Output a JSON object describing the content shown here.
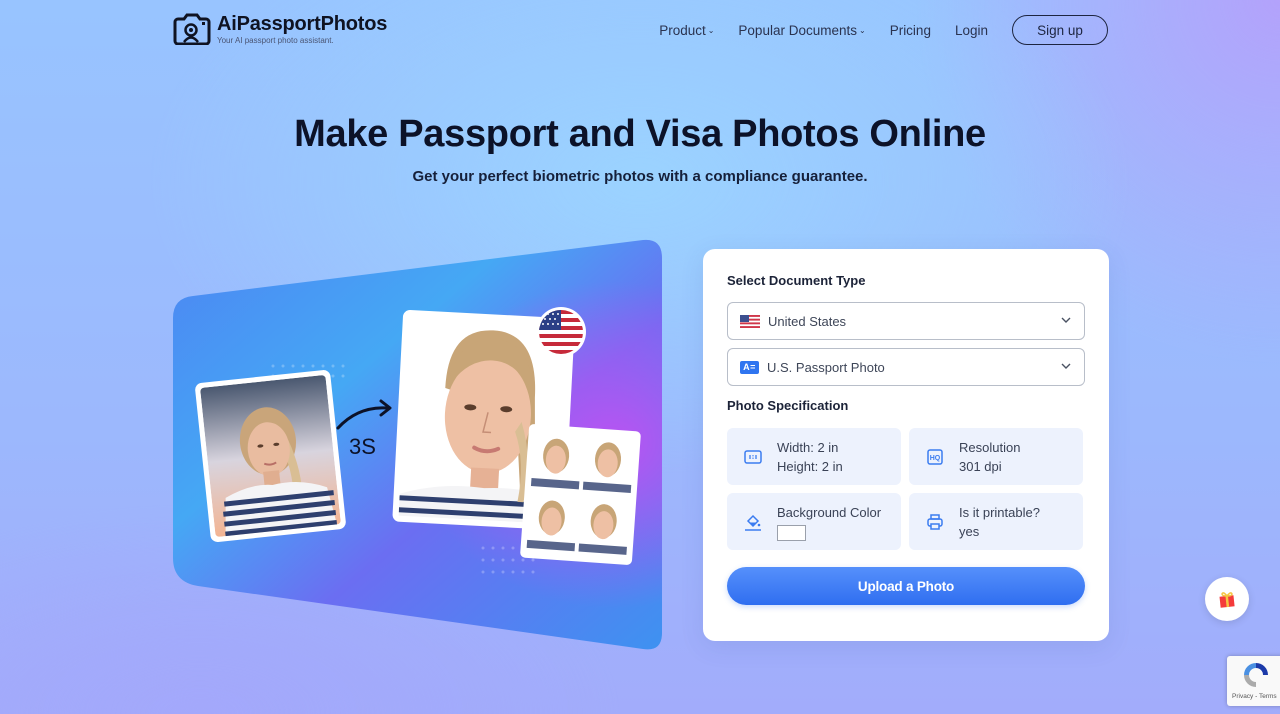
{
  "brand": {
    "name": "AiPassportPhotos",
    "tagline": "Your AI passport photo assistant."
  },
  "nav": {
    "items": [
      {
        "label": "Product",
        "has_dropdown": true
      },
      {
        "label": "Popular Documents",
        "has_dropdown": true
      },
      {
        "label": "Pricing",
        "has_dropdown": false
      },
      {
        "label": "Login",
        "has_dropdown": false
      }
    ],
    "signup_label": "Sign up",
    "chevron": "⌄"
  },
  "hero": {
    "title": "Make Passport and Visa Photos Online",
    "subtitle": "Get your perfect biometric photos with a compliance guarantee."
  },
  "illustration": {
    "time_label": "3S",
    "flag": "united-states-flag",
    "before_photo": "original-portrait-photo",
    "after_photo": "passport-portrait-photo",
    "print_sheet_count": 4
  },
  "form": {
    "select_document_label": "Select Document Type",
    "country": {
      "value": "United States",
      "icon": "us-flag-icon"
    },
    "document": {
      "value": "U.S. Passport Photo",
      "icon": "id-card-icon",
      "icon_text": "A="
    },
    "spec_label": "Photo Specification",
    "specs": [
      {
        "icon": "aspect-ratio-icon",
        "line1": "Width: 2 in",
        "line2": "Height: 2 in"
      },
      {
        "icon": "hq-resolution-icon",
        "line1": "Resolution",
        "line2": "301 dpi"
      },
      {
        "icon": "paint-bucket-icon",
        "line1": "Background Color",
        "swatch_color": "#ffffff"
      },
      {
        "icon": "printer-icon",
        "line1": "Is it printable?",
        "line2": "yes"
      }
    ],
    "upload_label": "Upload a Photo"
  },
  "widgets": {
    "gift": "gift-icon",
    "recaptcha_links": "Privacy - Terms"
  },
  "colors": {
    "accent": "#2f6ef0",
    "spec_bg": "#edf2fd",
    "title": "#0c1228"
  }
}
